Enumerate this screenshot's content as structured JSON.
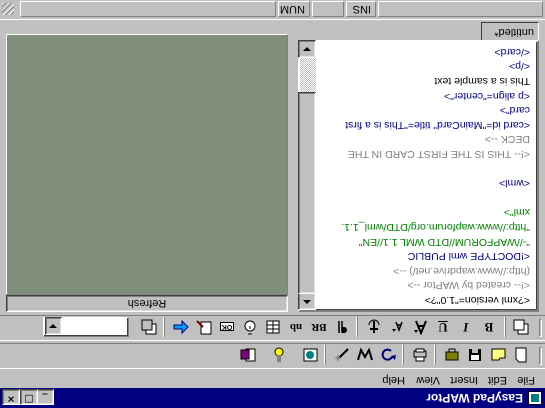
{
  "window": {
    "title": "EasyPad WAPtor",
    "min_label": "_",
    "max_label": "□",
    "close_label": "×"
  },
  "menu": [
    "File",
    "Edit",
    "Insert",
    "View",
    "Help"
  ],
  "toolbar_text": {
    "bold": "B",
    "italic": "I",
    "underline": "U",
    "br": "BR",
    "nb": "nb",
    "ok": "OK"
  },
  "editor": {
    "tab_label": "untitled*",
    "lines": [
      {
        "text": "<?xml version=\"1.0\"?>",
        "color": "#000000"
      },
      {
        "text": "<!-- created by WAPtor -->",
        "color": "#808080"
      },
      {
        "text": "(http://www.wapdrive.net/) -->",
        "color": "#808080"
      },
      {
        "text": "<!DOCTYPE wml PUBLIC",
        "color": "#000080"
      },
      {
        "text": "\"-//WAPFORUM//DTD WML 1.1//EN\"",
        "color": "#008000"
      },
      {
        "text": "\"http://www.wapforum.org/DTD/wml_1.1.",
        "color": "#008000"
      },
      {
        "text": "xml\">",
        "color": "#008000"
      },
      {
        "text": "",
        "color": "#000000"
      },
      {
        "text": "<wml>",
        "color": "#000080"
      },
      {
        "text": "",
        "color": "#000000"
      },
      {
        "text": "<!-- THIS IS THE FIRST CARD IN THE",
        "color": "#808080"
      },
      {
        "text": "DECK -->",
        "color": "#808080"
      },
      {
        "text": "<card id=\"MainCard\" title=\"This is a first",
        "color": "#000080"
      },
      {
        "text": "card\">",
        "color": "#000080"
      },
      {
        "text": "<p align=\"center\">",
        "color": "#000080"
      },
      {
        "text": "This is a sample text",
        "color": "#000000"
      },
      {
        "text": "</p>",
        "color": "#000080"
      },
      {
        "text": "</card>",
        "color": "#000080"
      }
    ]
  },
  "preview": {
    "refresh_label": "Refresh",
    "background": "#7f8f7b"
  },
  "status": {
    "num": "NUM",
    "ins": "INS"
  }
}
